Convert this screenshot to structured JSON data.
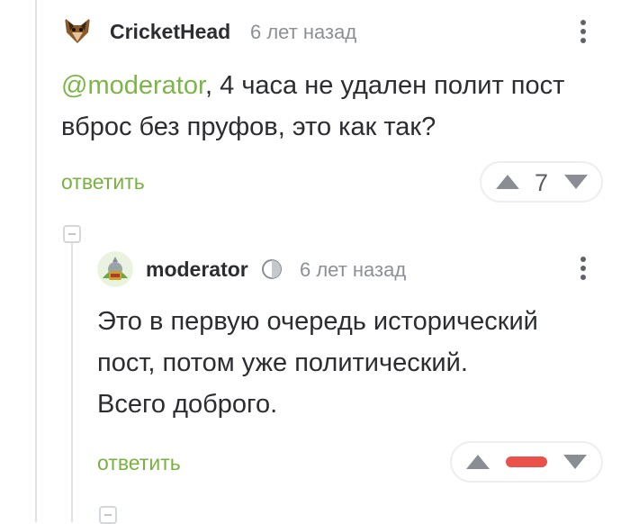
{
  "comments": [
    {
      "username": "CricketHead",
      "time": "6 лет назад",
      "mention": "@moderator",
      "text_line1_rest": ", 4 часа не удален полит пост",
      "text_line2": "вброс без пруфов, это как так?",
      "reply_label": "ответить",
      "score": "7"
    },
    {
      "username": "moderator",
      "time": "6 лет назад",
      "text_lines": [
        "Это в первую очередь исторический",
        "пост, потом уже политический.",
        "Всего доброго."
      ],
      "reply_label": "ответить",
      "score_state": "negative-hidden",
      "score_bar_color": "#e8524a"
    }
  ],
  "icons": {
    "avatar_1": "fox-avatar-icon",
    "avatar_2": "moderator-avatar-icon",
    "moderator_badge": "moderator-badge-icon",
    "menu": "kebab-menu-icon",
    "upvote": "arrow-up-icon",
    "downvote": "arrow-down-icon",
    "collapse": "collapse-minus-icon"
  },
  "colors": {
    "accent_green": "#79b240",
    "negative_red": "#e8524a",
    "arrow_gray": "#8a8e94"
  }
}
